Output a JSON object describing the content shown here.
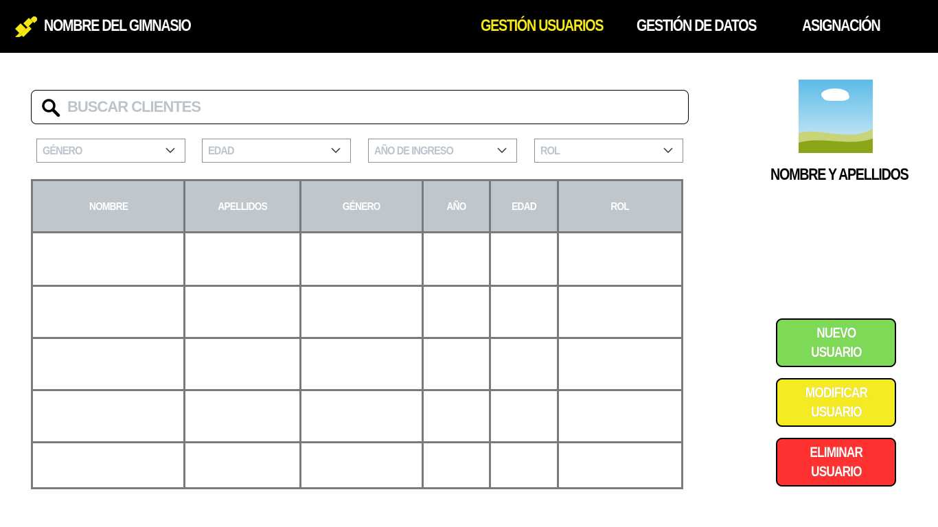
{
  "brand": {
    "name": "NOMBRE DEL GIMNASIO",
    "logo_icon": "gym-logo-icon"
  },
  "nav": {
    "items": [
      {
        "label": "GESTIÓN USUARIOS",
        "active": true
      },
      {
        "label": "GESTIÓN DE DATOS",
        "active": false
      },
      {
        "label": "ASIGNACIÓN",
        "active": false
      }
    ],
    "active_color": "#f5e815"
  },
  "search": {
    "placeholder": "BUSCAR CLIENTES",
    "value": "",
    "icon": "search-icon"
  },
  "filters": [
    {
      "label": "GÉNERO"
    },
    {
      "label": "EDAD"
    },
    {
      "label": "AÑO DE INGRESO"
    },
    {
      "label": "ROL"
    }
  ],
  "table": {
    "columns": [
      "NOMBRE",
      "APELLIDOS",
      "GÉNERO",
      "AÑO",
      "EDAD",
      "ROL"
    ],
    "rows": [
      [
        "",
        "",
        "",
        "",
        "",
        ""
      ],
      [
        "",
        "",
        "",
        "",
        "",
        ""
      ],
      [
        "",
        "",
        "",
        "",
        "",
        ""
      ],
      [
        "",
        "",
        "",
        "",
        "",
        ""
      ],
      [
        "",
        "",
        "",
        "",
        "",
        ""
      ]
    ],
    "header_color": "#c0c7cc"
  },
  "profile": {
    "photo_icon": "landscape-placeholder-icon",
    "name": "NOMBRE Y APELLIDOS"
  },
  "actions": {
    "new": {
      "line1": "NUEVO",
      "line2": "USUARIO",
      "color": "#7ed957"
    },
    "modify": {
      "line1": "MODIFICAR",
      "line2": "USUARIO",
      "color": "#f5eb25"
    },
    "delete": {
      "line1": "ELIMINAR",
      "line2": "USUARIO",
      "color": "#ff3131"
    }
  }
}
